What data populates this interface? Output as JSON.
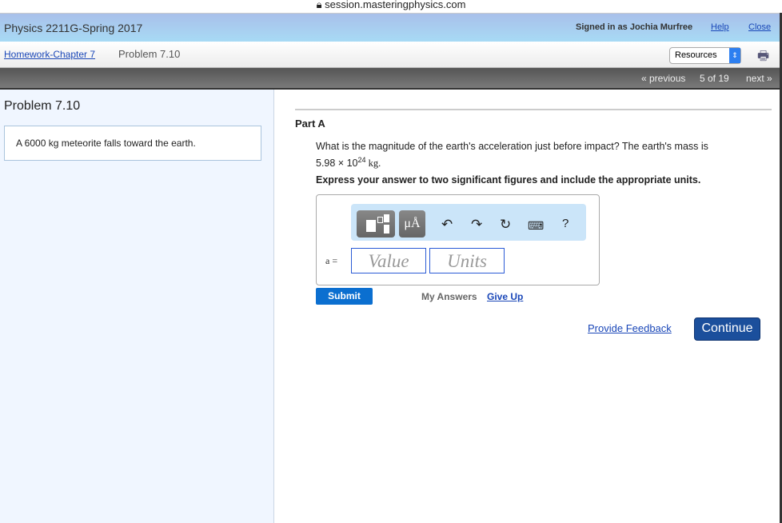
{
  "browser": {
    "url": "session.masteringphysics.com"
  },
  "header": {
    "course": "Physics 2211G-Spring 2017",
    "signed_in": "Signed in as Jochia Murfree",
    "help": "Help",
    "close": "Close"
  },
  "breadcrumb": {
    "parent": "Homework-Chapter 7",
    "current": "Problem 7.10",
    "resources": "Resources"
  },
  "pager": {
    "previous": "« previous",
    "position": "5 of 19",
    "next": "next »"
  },
  "problem": {
    "title": "Problem 7.10",
    "statement": "A 6000 kg meteorite falls toward the earth."
  },
  "part": {
    "title": "Part A",
    "question": "What is the magnitude of the earth's acceleration just before impact? The earth's mass is",
    "mass": "5.98 × 10",
    "exp": "24",
    "unit": " kg.",
    "instruction": "Express your answer to two significant figures and include the appropriate units."
  },
  "answer": {
    "var_label": "a =",
    "value_placeholder": "Value",
    "units_placeholder": "Units",
    "units_btn": "μÅ",
    "help_btn": "?"
  },
  "actions": {
    "submit": "Submit",
    "my_answers": "My Answers",
    "give_up": "Give Up",
    "feedback": "Provide Feedback",
    "continue": "Continue"
  }
}
